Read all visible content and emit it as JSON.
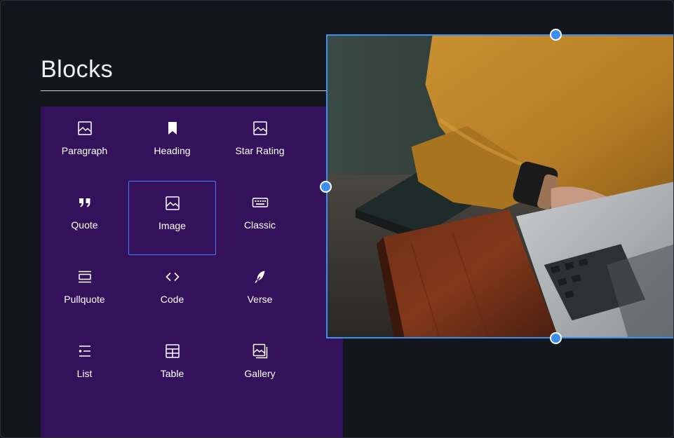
{
  "title": "Blocks",
  "blocks": [
    {
      "label": "Paragraph",
      "icon": "image-icon"
    },
    {
      "label": "Heading",
      "icon": "bookmark-icon"
    },
    {
      "label": "Star Rating",
      "icon": "image-icon"
    },
    {
      "label": "Quote",
      "icon": "quote-icon"
    },
    {
      "label": "Image",
      "icon": "image-icon"
    },
    {
      "label": "Classic",
      "icon": "keyboard-icon"
    },
    {
      "label": "Pullquote",
      "icon": "pullquote-icon"
    },
    {
      "label": "Code",
      "icon": "code-icon"
    },
    {
      "label": "Verse",
      "icon": "feather-icon"
    },
    {
      "label": "List",
      "icon": "list-icon"
    },
    {
      "label": "Table",
      "icon": "table-icon"
    },
    {
      "label": "Gallery",
      "icon": "gallery-icon"
    }
  ],
  "selected_block": "Image",
  "colors": {
    "background": "#13171d",
    "panel": "#34125b",
    "accent": "#3b8ff0",
    "text": "#ffffff"
  }
}
